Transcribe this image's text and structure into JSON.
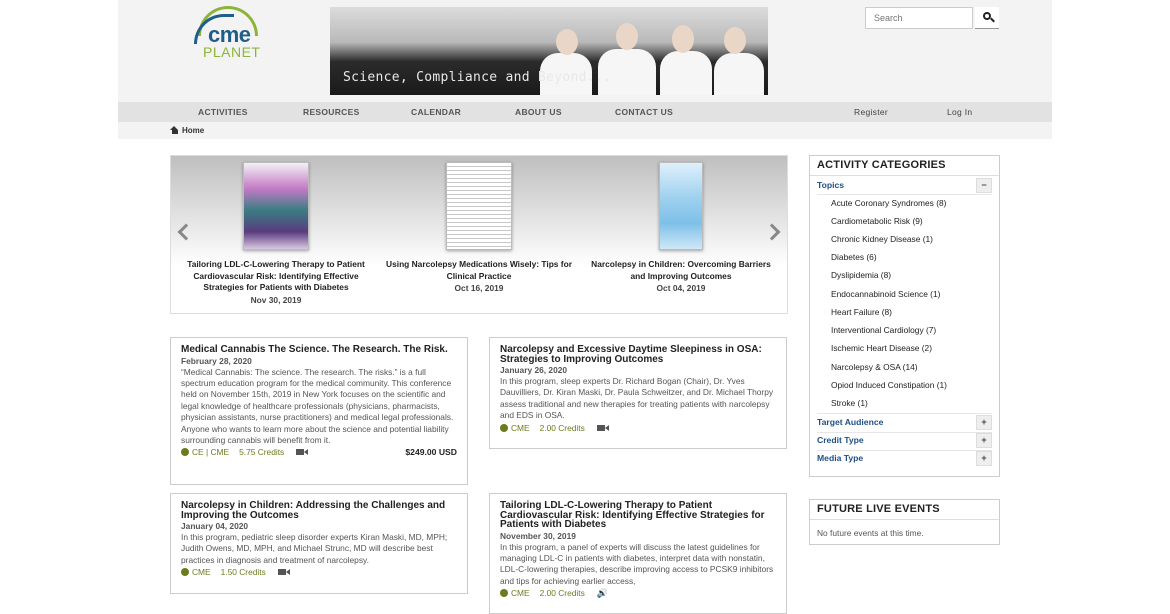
{
  "header": {
    "logo": {
      "text_top": "cme",
      "text_bottom": "PLANET"
    },
    "banner_tagline": "Science, Compliance and Beyond...",
    "search": {
      "placeholder": "Search"
    }
  },
  "nav": {
    "items": [
      "ACTIVITIES",
      "RESOURCES",
      "CALENDAR",
      "ABOUT US",
      "CONTACT US"
    ],
    "register": "Register",
    "login": "Log In"
  },
  "breadcrumb": {
    "home": "Home"
  },
  "carousel": {
    "slides": [
      {
        "title": "Tailoring LDL-C-Lowering Therapy to Patient Cardiovascular Risk: Identifying Effective Strategies for Patients with Diabetes",
        "date": "Nov 30, 2019"
      },
      {
        "title": "Using Narcolepsy Medications Wisely: Tips for Clinical Practice",
        "date": "Oct 16, 2019"
      },
      {
        "title": "Narcolepsy in Children: Overcoming Barriers and Improving Outcomes",
        "date": "Oct 04, 2019"
      }
    ]
  },
  "activities": [
    {
      "title": "Medical Cannabis The Science. The Research. The Risk.",
      "date": "February 28, 2020",
      "body": "“Medical Cannabis: The science. The research. The risks.” is a full spectrum education program for the medical community. This conference held on November 15th, 2019 in New York focuses on the scientific and legal knowledge of healthcare professionals (physicians, pharmacists, physician assistants, nurse practitioners) and medical legal professionals. Anyone who wants to learn more about the science and potential liability surrounding cannabis will benefit from it.",
      "type": "CE | CME",
      "credits": "5.75 Credits",
      "media_icon": "video-icon",
      "price": "$249.00 USD"
    },
    {
      "title": "Narcolepsy and Excessive Daytime Sleepiness in OSA: Strategies to Improving Outcomes",
      "date": "January 26, 2020",
      "body": "In this program, sleep experts Dr. Richard Bogan (Chair), Dr. Yves Dauvilliers, Dr. Kiran Maski, Dr. Paula Schweitzer, and Dr. Michael Thorpy assess traditional and new therapies for treating patients with narcolepsy and EDS in OSA.",
      "type": "CME",
      "credits": "2.00 Credits",
      "media_icon": "video-icon"
    },
    {
      "title": "Narcolepsy in Children: Addressing the Challenges and Improving the Outcomes",
      "date": "January 04, 2020",
      "body": "In this program, pediatric sleep disorder experts Kiran Maski, MD, MPH; Judith Owens, MD, MPH, and Michael Strunc, MD will describe best practices in diagnosis and treatment of narcolepsy.",
      "type": "CME",
      "credits": "1.50 Credits",
      "media_icon": "video-icon"
    },
    {
      "title": "Tailoring LDL-C-Lowering Therapy to Patient Cardiovascular Risk: Identifying Effective Strategies for Patients with Diabetes",
      "date": "November 30, 2019",
      "body": "In this program, a panel of experts will discuss the latest guidelines for managing LDL-C in patients with diabetes, interpret data with nonstatin, LDL-C-lowering therapies, describe improving access to PCSK9 inhibitors and tips for achieving earlier access,",
      "type": "CME",
      "credits": "2.00 Credits",
      "media_icon": "audio-icon"
    }
  ],
  "sidebar": {
    "categories_title": "ACTIVITY CATEGORIES",
    "topics_label": "Topics",
    "topics_toggle": "−",
    "topics": [
      "Acute Coronary Syndromes (8)",
      "Cardiometabolic Risk (9)",
      "Chronic Kidney Disease (1)",
      "Diabetes (6)",
      "Dyslipidemia (8)",
      "Endocannabinoid Science (1)",
      "Heart Failure (8)",
      "Interventional Cardiology (7)",
      "Ischemic Heart Disease (2)",
      "Narcolepsy & OSA (14)",
      "Opiod Induced Constipation (1)",
      "Stroke (1)"
    ],
    "collapsed_groups": [
      {
        "label": "Target Audience",
        "toggle": "+"
      },
      {
        "label": "Credit Type",
        "toggle": "+"
      },
      {
        "label": "Media Type",
        "toggle": "+"
      }
    ],
    "future_title": "FUTURE LIVE EVENTS",
    "future_empty": "No future events at this time."
  },
  "colors": {
    "brand_blue": "#1f5d8a",
    "brand_green": "#8db43a",
    "credit_green": "#6b7c1e",
    "link_blue": "#1f4f86"
  }
}
